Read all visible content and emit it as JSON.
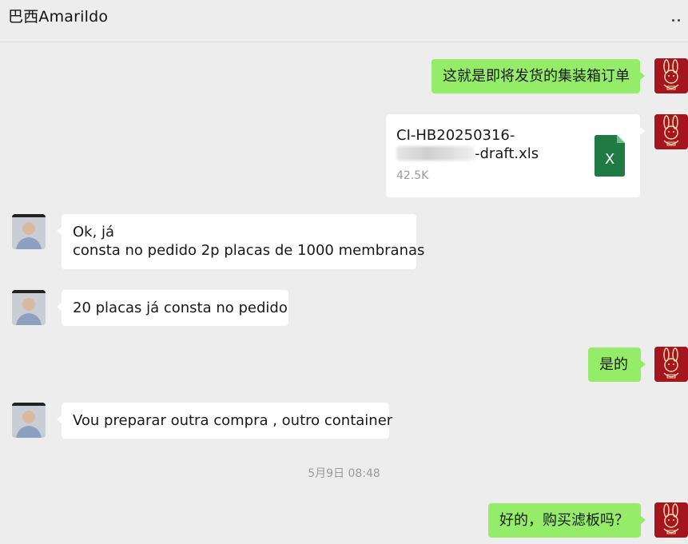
{
  "header": {
    "title": "巴西Amarildo",
    "more_icon": "more-dots-icon"
  },
  "messages": [
    {
      "side": "out",
      "type": "text",
      "text": "这就是即将发货的集装箱订单"
    },
    {
      "side": "out",
      "type": "file",
      "file_name_line1": "CI-HB20250316-",
      "file_name_line2_suffix": "-draft.xls",
      "file_size": "42.5K",
      "file_icon": "excel-file-icon"
    },
    {
      "side": "in",
      "type": "text",
      "line1": "Ok, já",
      "line2": "consta no pedido 2p placas de 1000 membranas"
    },
    {
      "side": "in",
      "type": "text",
      "text": "20 placas já consta no pedido"
    },
    {
      "side": "out",
      "type": "text",
      "text": "是的"
    },
    {
      "side": "in",
      "type": "text",
      "text": "Vou preparar outra compra , outro container"
    },
    {
      "side": "out",
      "type": "text",
      "text": "好的，购买滤板吗？"
    }
  ],
  "timestamp": "5月9日 08:48",
  "colors": {
    "outgoing_bubble": "#95ec69",
    "incoming_bubble": "#ffffff",
    "background": "#ededed",
    "self_avatar": "#a5151d"
  }
}
